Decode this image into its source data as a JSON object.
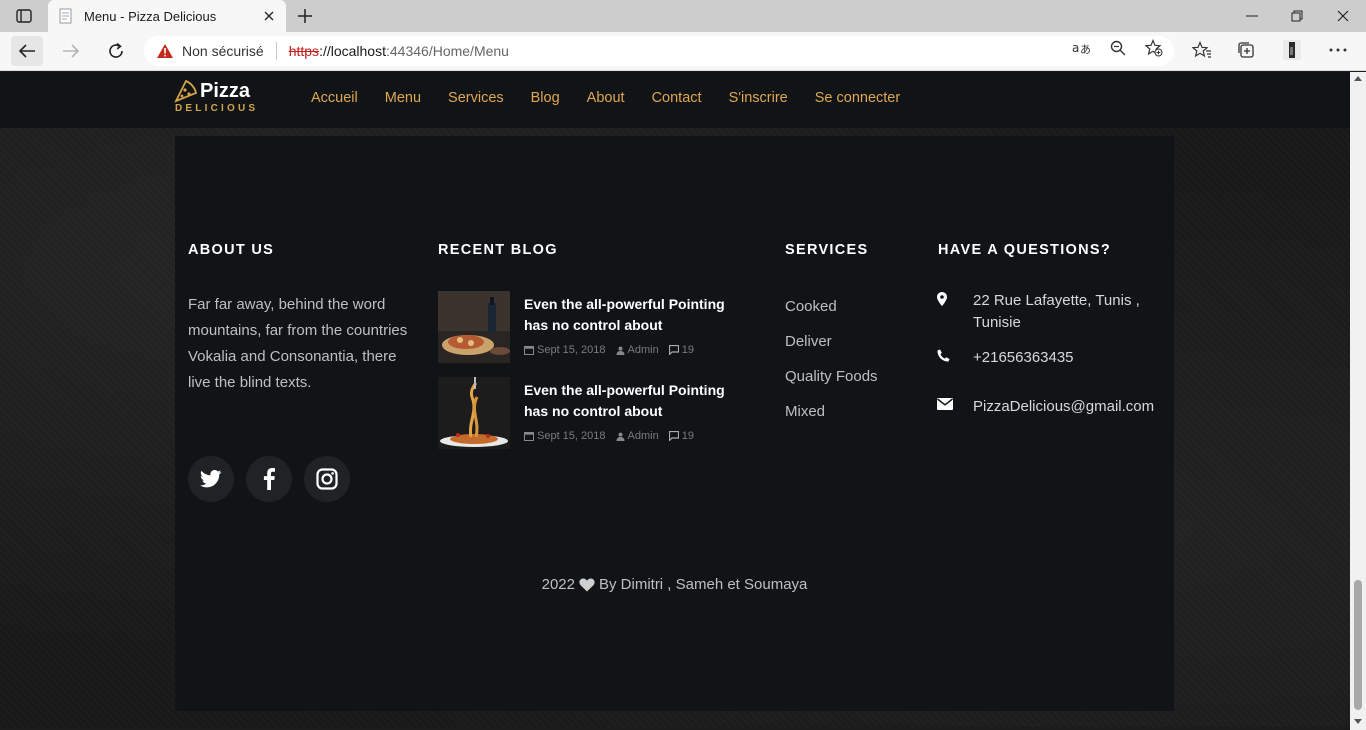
{
  "browser": {
    "tab_title": "Menu - Pizza Delicious",
    "security_label": "Non sécurisé",
    "url_scheme": "https",
    "url_host": "://localhost",
    "url_rest": ":44346/Home/Menu"
  },
  "site": {
    "logo_word": "Pizza",
    "logo_sub": "DELICIOUS",
    "nav": [
      "Accueil",
      "Menu",
      "Services",
      "Blog",
      "About",
      "Contact",
      "S'inscrire",
      "Se connecter"
    ],
    "accent_color": "#e0a650"
  },
  "footer": {
    "about_title": "ABOUT US",
    "about_text": "Far far away, behind the word mountains, far from the countries Vokalia and Consonantia, there live the blind texts.",
    "blog_title": "RECENT BLOG",
    "posts": [
      {
        "title": "Even the all-powerful Pointing has no control about",
        "date": "Sept 15, 2018",
        "author": "Admin",
        "comments": "19"
      },
      {
        "title": "Even the all-powerful Pointing has no control about",
        "date": "Sept 15, 2018",
        "author": "Admin",
        "comments": "19"
      }
    ],
    "services_title": "SERVICES",
    "services": [
      "Cooked",
      "Deliver",
      "Quality Foods",
      "Mixed"
    ],
    "contact_title": "HAVE A QUESTIONS?",
    "address": "22 Rue Lafayette, Tunis , Tunisie",
    "phone": "+21656363435",
    "email": "PizzaDelicious@gmail.com",
    "copyright_year": "2022",
    "copyright_by": "By Dimitri , Sameh et Soumaya",
    "social_icons": [
      "twitter-icon",
      "facebook-icon",
      "instagram-icon"
    ]
  }
}
